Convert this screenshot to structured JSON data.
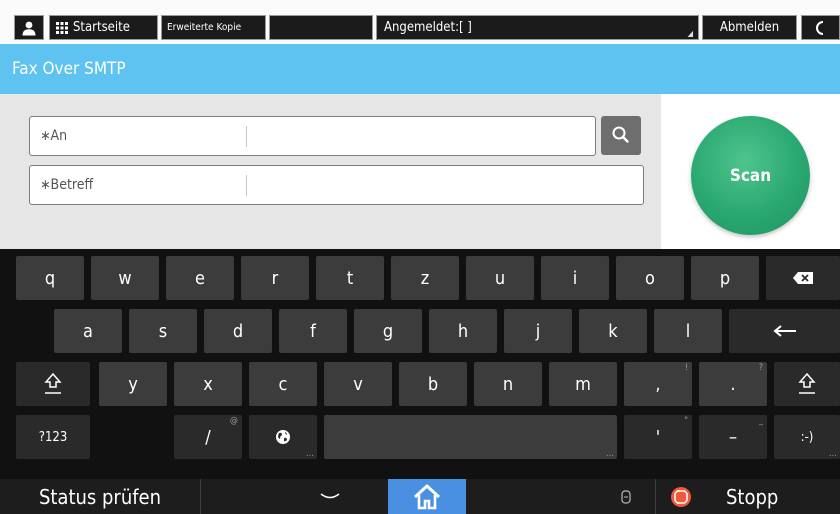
{
  "topbar": {
    "home_label": "Startseite",
    "app_label": "Erweiterte Kopie",
    "login_status": "Angemeldet:[ ]",
    "logout_label": "Abmelden"
  },
  "app": {
    "title": "Fax Over SMTP"
  },
  "form": {
    "to_label": "∗An",
    "subject_label": "∗Betreff",
    "scan_label": "Scan"
  },
  "keyboard": {
    "row1": [
      "q",
      "w",
      "e",
      "r",
      "t",
      "z",
      "u",
      "i",
      "o",
      "p"
    ],
    "row2": [
      "a",
      "s",
      "d",
      "f",
      "g",
      "h",
      "j",
      "k",
      "l"
    ],
    "row3": [
      "y",
      "x",
      "c",
      "v",
      "b",
      "n",
      "m",
      ",",
      "."
    ],
    "row3_hints": [
      "!",
      "?"
    ],
    "row4": {
      "sym": "?123",
      "slash": "/",
      "slash_hint": "@",
      "apostrophe": "'",
      "apostrophe_hint": "\"",
      "dash": "–",
      "dash_hint": "_",
      "smiley": ":-)"
    }
  },
  "bottombar": {
    "status_label": "Status prüfen",
    "stop_label": "Stopp"
  },
  "colors": {
    "title_bar": "#5ec3f0",
    "scan_button": "#2aa871",
    "home_active": "#4a90e2",
    "stop_icon": "#ef5a3c"
  },
  "icons": {
    "user": "user-icon",
    "grid": "grid-icon",
    "search": "search-icon",
    "backspace": "backspace-icon",
    "enter": "enter-icon",
    "shift": "shift-icon",
    "globe": "globe-icon",
    "home": "home-icon",
    "stop": "stop-icon"
  }
}
